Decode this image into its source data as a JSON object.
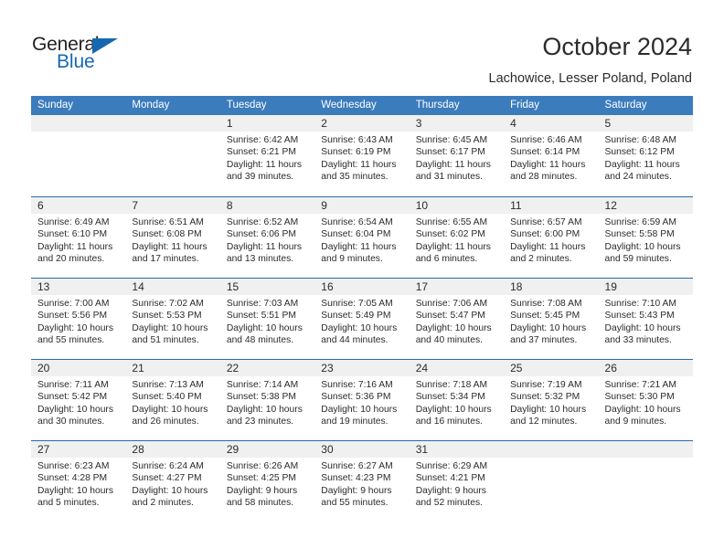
{
  "brand": {
    "name_top": "General",
    "name_bottom": "Blue",
    "accent_color": "#1568b0",
    "triangle_icon": "triangle-icon"
  },
  "header": {
    "title": "October 2024",
    "subtitle": "Lachowice, Lesser Poland, Poland"
  },
  "calendar": {
    "header_bg": "#3b7cbd",
    "row_divider": "#2a6aa8",
    "daynum_bg": "#f0f0f0",
    "weekdays": [
      "Sunday",
      "Monday",
      "Tuesday",
      "Wednesday",
      "Thursday",
      "Friday",
      "Saturday"
    ],
    "weeks": [
      [
        {
          "day": "",
          "lines": []
        },
        {
          "day": "",
          "lines": []
        },
        {
          "day": "1",
          "lines": [
            "Sunrise: 6:42 AM",
            "Sunset: 6:21 PM",
            "Daylight: 11 hours",
            "and 39 minutes."
          ]
        },
        {
          "day": "2",
          "lines": [
            "Sunrise: 6:43 AM",
            "Sunset: 6:19 PM",
            "Daylight: 11 hours",
            "and 35 minutes."
          ]
        },
        {
          "day": "3",
          "lines": [
            "Sunrise: 6:45 AM",
            "Sunset: 6:17 PM",
            "Daylight: 11 hours",
            "and 31 minutes."
          ]
        },
        {
          "day": "4",
          "lines": [
            "Sunrise: 6:46 AM",
            "Sunset: 6:14 PM",
            "Daylight: 11 hours",
            "and 28 minutes."
          ]
        },
        {
          "day": "5",
          "lines": [
            "Sunrise: 6:48 AM",
            "Sunset: 6:12 PM",
            "Daylight: 11 hours",
            "and 24 minutes."
          ]
        }
      ],
      [
        {
          "day": "6",
          "lines": [
            "Sunrise: 6:49 AM",
            "Sunset: 6:10 PM",
            "Daylight: 11 hours",
            "and 20 minutes."
          ]
        },
        {
          "day": "7",
          "lines": [
            "Sunrise: 6:51 AM",
            "Sunset: 6:08 PM",
            "Daylight: 11 hours",
            "and 17 minutes."
          ]
        },
        {
          "day": "8",
          "lines": [
            "Sunrise: 6:52 AM",
            "Sunset: 6:06 PM",
            "Daylight: 11 hours",
            "and 13 minutes."
          ]
        },
        {
          "day": "9",
          "lines": [
            "Sunrise: 6:54 AM",
            "Sunset: 6:04 PM",
            "Daylight: 11 hours",
            "and 9 minutes."
          ]
        },
        {
          "day": "10",
          "lines": [
            "Sunrise: 6:55 AM",
            "Sunset: 6:02 PM",
            "Daylight: 11 hours",
            "and 6 minutes."
          ]
        },
        {
          "day": "11",
          "lines": [
            "Sunrise: 6:57 AM",
            "Sunset: 6:00 PM",
            "Daylight: 11 hours",
            "and 2 minutes."
          ]
        },
        {
          "day": "12",
          "lines": [
            "Sunrise: 6:59 AM",
            "Sunset: 5:58 PM",
            "Daylight: 10 hours",
            "and 59 minutes."
          ]
        }
      ],
      [
        {
          "day": "13",
          "lines": [
            "Sunrise: 7:00 AM",
            "Sunset: 5:56 PM",
            "Daylight: 10 hours",
            "and 55 minutes."
          ]
        },
        {
          "day": "14",
          "lines": [
            "Sunrise: 7:02 AM",
            "Sunset: 5:53 PM",
            "Daylight: 10 hours",
            "and 51 minutes."
          ]
        },
        {
          "day": "15",
          "lines": [
            "Sunrise: 7:03 AM",
            "Sunset: 5:51 PM",
            "Daylight: 10 hours",
            "and 48 minutes."
          ]
        },
        {
          "day": "16",
          "lines": [
            "Sunrise: 7:05 AM",
            "Sunset: 5:49 PM",
            "Daylight: 10 hours",
            "and 44 minutes."
          ]
        },
        {
          "day": "17",
          "lines": [
            "Sunrise: 7:06 AM",
            "Sunset: 5:47 PM",
            "Daylight: 10 hours",
            "and 40 minutes."
          ]
        },
        {
          "day": "18",
          "lines": [
            "Sunrise: 7:08 AM",
            "Sunset: 5:45 PM",
            "Daylight: 10 hours",
            "and 37 minutes."
          ]
        },
        {
          "day": "19",
          "lines": [
            "Sunrise: 7:10 AM",
            "Sunset: 5:43 PM",
            "Daylight: 10 hours",
            "and 33 minutes."
          ]
        }
      ],
      [
        {
          "day": "20",
          "lines": [
            "Sunrise: 7:11 AM",
            "Sunset: 5:42 PM",
            "Daylight: 10 hours",
            "and 30 minutes."
          ]
        },
        {
          "day": "21",
          "lines": [
            "Sunrise: 7:13 AM",
            "Sunset: 5:40 PM",
            "Daylight: 10 hours",
            "and 26 minutes."
          ]
        },
        {
          "day": "22",
          "lines": [
            "Sunrise: 7:14 AM",
            "Sunset: 5:38 PM",
            "Daylight: 10 hours",
            "and 23 minutes."
          ]
        },
        {
          "day": "23",
          "lines": [
            "Sunrise: 7:16 AM",
            "Sunset: 5:36 PM",
            "Daylight: 10 hours",
            "and 19 minutes."
          ]
        },
        {
          "day": "24",
          "lines": [
            "Sunrise: 7:18 AM",
            "Sunset: 5:34 PM",
            "Daylight: 10 hours",
            "and 16 minutes."
          ]
        },
        {
          "day": "25",
          "lines": [
            "Sunrise: 7:19 AM",
            "Sunset: 5:32 PM",
            "Daylight: 10 hours",
            "and 12 minutes."
          ]
        },
        {
          "day": "26",
          "lines": [
            "Sunrise: 7:21 AM",
            "Sunset: 5:30 PM",
            "Daylight: 10 hours",
            "and 9 minutes."
          ]
        }
      ],
      [
        {
          "day": "27",
          "lines": [
            "Sunrise: 6:23 AM",
            "Sunset: 4:28 PM",
            "Daylight: 10 hours",
            "and 5 minutes."
          ]
        },
        {
          "day": "28",
          "lines": [
            "Sunrise: 6:24 AM",
            "Sunset: 4:27 PM",
            "Daylight: 10 hours",
            "and 2 minutes."
          ]
        },
        {
          "day": "29",
          "lines": [
            "Sunrise: 6:26 AM",
            "Sunset: 4:25 PM",
            "Daylight: 9 hours",
            "and 58 minutes."
          ]
        },
        {
          "day": "30",
          "lines": [
            "Sunrise: 6:27 AM",
            "Sunset: 4:23 PM",
            "Daylight: 9 hours",
            "and 55 minutes."
          ]
        },
        {
          "day": "31",
          "lines": [
            "Sunrise: 6:29 AM",
            "Sunset: 4:21 PM",
            "Daylight: 9 hours",
            "and 52 minutes."
          ]
        },
        {
          "day": "",
          "lines": []
        },
        {
          "day": "",
          "lines": []
        }
      ]
    ]
  }
}
